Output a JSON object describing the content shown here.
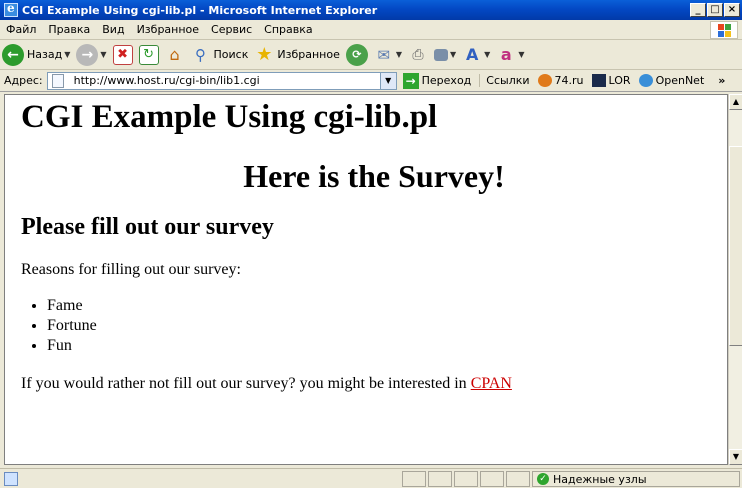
{
  "window": {
    "title": "CGI Example Using cgi-lib.pl - Microsoft Internet Explorer",
    "minimize": "_",
    "maximize": "□",
    "close": "×"
  },
  "menu": {
    "items": [
      "Файл",
      "Правка",
      "Вид",
      "Избранное",
      "Сервис",
      "Справка"
    ]
  },
  "toolbar": {
    "back_label": "Назад",
    "search_label": "Поиск",
    "favorites_label": "Избранное"
  },
  "address": {
    "label": "Адрес:",
    "url": "http://www.host.ru/cgi-bin/lib1.cgi",
    "go_label": "Переход",
    "links_label": "Ссылки",
    "links": [
      "74.ru",
      "LOR",
      "OpenNet"
    ],
    "more": "»"
  },
  "page": {
    "title": "CGI Example Using cgi-lib.pl",
    "subtitle": "Here is the Survey!",
    "section": "Please fill out our survey",
    "reasons_text": "Reasons for filling out our survey:",
    "reasons": [
      "Fame",
      "Fortune",
      "Fun"
    ],
    "footer_text": "If you would rather not fill out our survey? you might be interested in ",
    "footer_link": "CPAN"
  },
  "status": {
    "zone": "Надежные узлы"
  },
  "colors": {
    "titlebar": "#0348c4",
    "link": "#cc0000",
    "chrome": "#ece9d8"
  }
}
